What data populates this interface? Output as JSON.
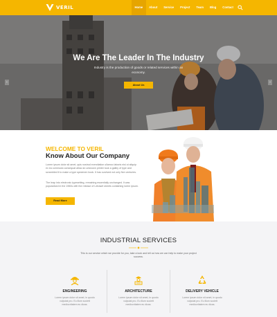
{
  "brand": {
    "name": "VERIL",
    "accent": "#f5b600"
  },
  "nav": {
    "items": [
      {
        "label": "Home",
        "active": true
      },
      {
        "label": "About"
      },
      {
        "label": "Service"
      },
      {
        "label": "Project"
      },
      {
        "label": "Team"
      },
      {
        "label": "Blog"
      },
      {
        "label": "Contact"
      }
    ],
    "search_icon": "search-icon"
  },
  "hero": {
    "title": "We Are The Leader In The Industry",
    "subtitle": "Industry is the production of goods or related services within an economy.",
    "button": "About Us",
    "prev_icon": "chevron-left-icon",
    "next_icon": "chevron-right-icon"
  },
  "about": {
    "welcome": "WELCOME TO VERIL",
    "heading": "Know About Our Company",
    "paragraph1": "Lorem ipsum dolor sit amet, quis nostrud exercitation ullamco laboris nisi ut aliquip ex ea commodo consequat allow an unknown printer took a galley of type and scrambled it to make a type specimen book. It has survived not only five centuries.",
    "paragraph2": "The leap into electronic typesetting, remaining essentially unchanged. It was popularised in the 1960s with the release of Letraset sheets containing lorem ipsum.",
    "button": "Read More"
  },
  "services": {
    "title": "INDUSTRIAL SERVICES",
    "subtitle": "This is our service which we provide for you, take a look and tell us how we can help to make your project success.",
    "items": [
      {
        "name": "ENGINEERING",
        "icon": "engineer-icon",
        "desc": "Lorem ipsum dolor sit amet, in quodo vulputat pro. Eu illum societt mediocritatem eu dicas."
      },
      {
        "name": "ARCHITECTURE",
        "icon": "architect-icon",
        "desc": "Lorem ipsum dolor sit amet, in quodo vulputat pro. Eu illum societt mediocritatem eu dicas."
      },
      {
        "name": "DELIVERY VEHICLE",
        "icon": "recycle-icon",
        "desc": "Lorem ipsum dolor sit amet, in quodo vulputat pro. Eu illum societt mediocritatem eu dicas."
      }
    ]
  }
}
